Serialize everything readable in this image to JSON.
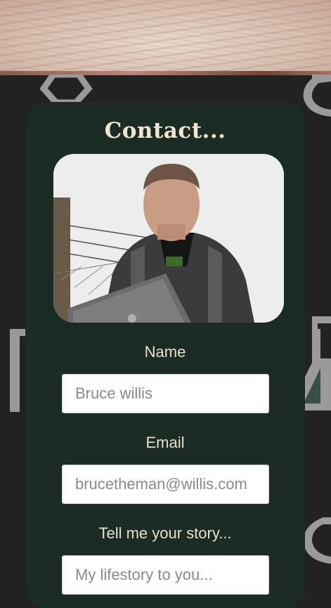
{
  "page": {
    "title": "Contact..."
  },
  "form": {
    "name_label": "Name",
    "name_placeholder": "Bruce willis",
    "email_label": "Email",
    "email_placeholder": "brucetheman@willis.com",
    "story_label": "Tell me your story...",
    "story_placeholder": "My lifestory to you..."
  },
  "icons": [
    "hexagon-molecule-icon",
    "flask-icon",
    "test-tube-icon",
    "molecule-icon"
  ],
  "colors": {
    "background": "#222222",
    "card": "#1c2c24",
    "title": "#efe6d2",
    "label": "#e6dfcf",
    "icon": "#9a9a9a"
  }
}
